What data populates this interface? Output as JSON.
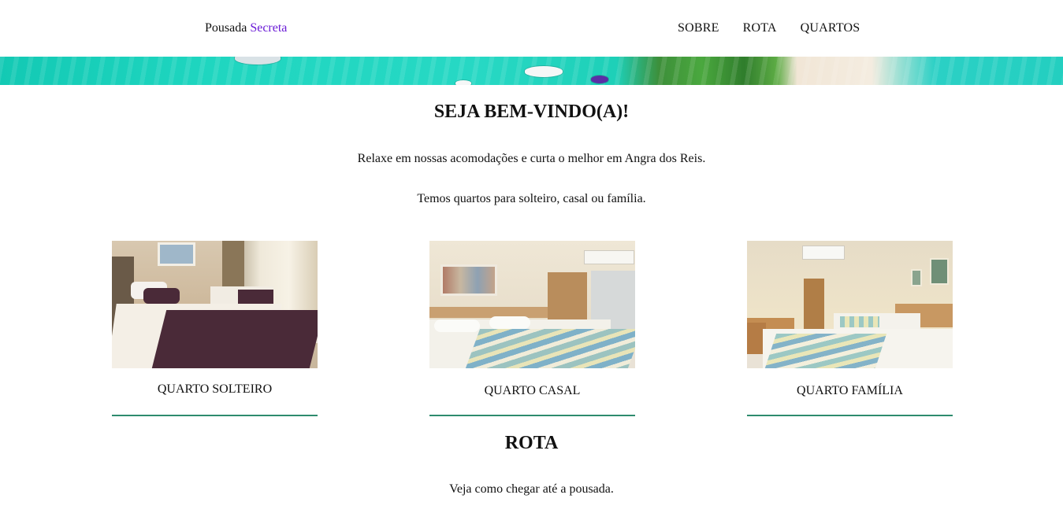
{
  "header": {
    "brand_part1": "Pousada",
    "brand_part2": "Secreta",
    "nav": [
      {
        "label": "SOBRE"
      },
      {
        "label": "ROTA"
      },
      {
        "label": "QUARTOS"
      }
    ]
  },
  "colors": {
    "brand_accent": "#6a1bd6",
    "divider": "#2e8b6e"
  },
  "welcome": {
    "title": "SEJA BEM-VINDO(A)!",
    "line1": "Relaxe em nossas acomodações e curta o melhor em Angra dos Reis.",
    "line2": "Temos quartos para solteiro, casal ou família."
  },
  "rooms": [
    {
      "name": "QUARTO SOLTEIRO"
    },
    {
      "name": "QUARTO CASAL"
    },
    {
      "name": "QUARTO FAMÍLIA"
    }
  ],
  "route": {
    "title": "ROTA",
    "text": "Veja como chegar até a pousada."
  }
}
